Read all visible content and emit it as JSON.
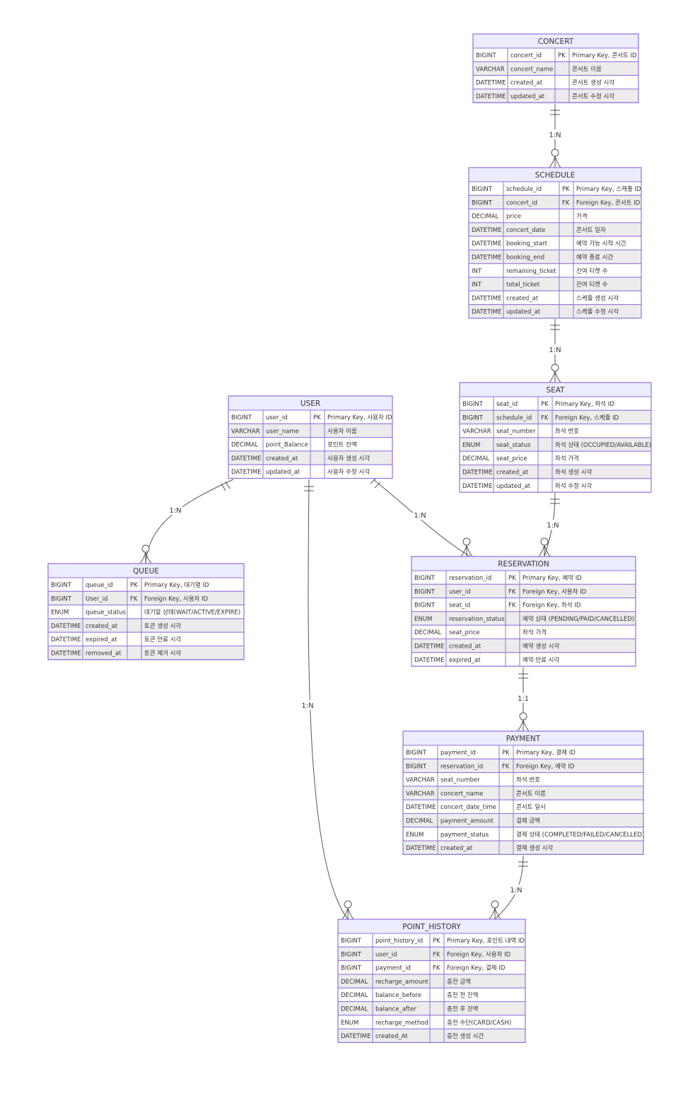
{
  "entities": [
    {
      "id": "CONCERT",
      "name": "CONCERT",
      "attributes": [
        [
          "BIGINT",
          "concert_id",
          "PK",
          "Primary Key, 콘서트 ID"
        ],
        [
          "VARCHAR",
          "concert_name",
          "",
          "콘서트 이름"
        ],
        [
          "DATETIME",
          "created_at",
          "",
          "콘서트 생성 시각"
        ],
        [
          "DATETIME",
          "updated_at",
          "",
          "콘서트 수정 시각"
        ]
      ]
    },
    {
      "id": "SCHEDULE",
      "name": "SCHEDULE",
      "attributes": [
        [
          "BIGINT",
          "schedule_id",
          "PK",
          "Primary Key, 스케줄 ID"
        ],
        [
          "BIGINT",
          "concert_id",
          "FK",
          "Foreign Key, 콘서트 ID"
        ],
        [
          "DECIMAL",
          "price",
          "",
          "가격"
        ],
        [
          "DATETIME",
          "concert_date",
          "",
          "콘서트 일자"
        ],
        [
          "DATETIME",
          "booking_start",
          "",
          "예약 가능 시작 시간"
        ],
        [
          "DATETIME",
          "booking_end",
          "",
          "예약 종료 시간"
        ],
        [
          "INT",
          "remaining_ticket",
          "",
          "잔여 티켓 수"
        ],
        [
          "INT",
          "total_ticket",
          "",
          "잔여 티켓 수"
        ],
        [
          "DATETIME",
          "created_at",
          "",
          "스케줄 생성 시각"
        ],
        [
          "DATETIME",
          "updated_at",
          "",
          "스케줄 수정 시각"
        ]
      ]
    },
    {
      "id": "SEAT",
      "name": "SEAT",
      "attributes": [
        [
          "BIGINT",
          "seat_id",
          "PK",
          "Primary Key, 좌석 ID"
        ],
        [
          "BIGINT",
          "schedule_id",
          "FK",
          "Foreign Key, 스케줄 ID"
        ],
        [
          "VARCHAR",
          "seat_number",
          "",
          "좌석 번호"
        ],
        [
          "ENUM",
          "seat_status",
          "",
          "좌석 상태 (OCCUPIED/AVAILABLE)"
        ],
        [
          "DECIMAL",
          "seat_price",
          "",
          "좌석 가격"
        ],
        [
          "DATETIME",
          "created_at",
          "",
          "좌석 생성 시각"
        ],
        [
          "DATETIME",
          "updated_at",
          "",
          "좌석 수정 시각"
        ]
      ]
    },
    {
      "id": "USER",
      "name": "USER",
      "attributes": [
        [
          "BIGINT",
          "user_id",
          "PK",
          "Primary Key, 사용자 ID"
        ],
        [
          "VARCHAR",
          "user_name",
          "",
          "사용자 이름"
        ],
        [
          "DECIMAL",
          "point_Balance",
          "",
          "포인트 잔액"
        ],
        [
          "DATETIME",
          "created_at",
          "",
          "사용자 생성 시각"
        ],
        [
          "DATETIME",
          "updated_at",
          "",
          "사용자 수정 시각"
        ]
      ]
    },
    {
      "id": "QUEUE",
      "name": "QUEUE",
      "attributes": [
        [
          "BIGINT",
          "queue_id",
          "PK",
          "Primary Key, 대기열 ID"
        ],
        [
          "BIGINT",
          "User_id",
          "FK",
          "Foreign Key, 사용자 ID"
        ],
        [
          "ENUM",
          "queue_status",
          "",
          "대기열 상태(WAIT/ACTIVE/EXPIRE)"
        ],
        [
          "DATETIME",
          "created_at",
          "",
          "토큰 생성 시각"
        ],
        [
          "DATETIME",
          "expired_at",
          "",
          "토큰 만료 시각"
        ],
        [
          "DATETIME",
          "removed_at",
          "",
          "토큰 제거 시각"
        ]
      ]
    },
    {
      "id": "RESERVATION",
      "name": "RESERVATION",
      "attributes": [
        [
          "BIGINT",
          "reservation_id",
          "PK",
          "Primary Key, 예약 ID"
        ],
        [
          "BIGINT",
          "user_id",
          "FK",
          "Foreign Key, 사용자 ID"
        ],
        [
          "BIGINT",
          "seat_id",
          "FK",
          "Foreign Key, 좌석 ID"
        ],
        [
          "ENUM",
          "reservation_status",
          "",
          "예약 상태 (PENDING/PAID/CANCELLED)"
        ],
        [
          "DECIMAL",
          "seat_price",
          "",
          "좌석 가격"
        ],
        [
          "DATETIME",
          "created_at",
          "",
          "예약 생성 시각"
        ],
        [
          "DATETIME",
          "expired_at",
          "",
          "예약 만료 시각"
        ]
      ]
    },
    {
      "id": "PAYMENT",
      "name": "PAYMENT",
      "attributes": [
        [
          "BIGINT",
          "payment_id",
          "PK",
          "Primary Key, 결제 ID"
        ],
        [
          "BIGINT",
          "reservation_id",
          "FK",
          "Foreign Key, 예약 ID"
        ],
        [
          "VARCHAR",
          "seat_number",
          "",
          "좌석 번호"
        ],
        [
          "VARCHAR",
          "concert_name",
          "",
          "콘서트 이름"
        ],
        [
          "DATETIME",
          "concert_date_time",
          "",
          "콘서트 일시"
        ],
        [
          "DECIMAL",
          "payment_amount",
          "",
          "결제 금액"
        ],
        [
          "ENUM",
          "payment_status",
          "",
          "결제 상태 (COMPLETED/FAILED/CANCELLED)"
        ],
        [
          "DATETIME",
          "created_at",
          "",
          "결제 생성 시각"
        ]
      ]
    },
    {
      "id": "POINT_HISTORY",
      "name": "POINT_HISTORY",
      "attributes": [
        [
          "BIGINT",
          "point_history_id",
          "PK",
          "Primary Key, 포인트 내역 ID"
        ],
        [
          "BIGINT",
          "user_id",
          "FK",
          "Foreign Key, 사용자 ID"
        ],
        [
          "BIGINT",
          "payment_id",
          "FK",
          "Foreign Key, 결제 ID"
        ],
        [
          "DECIMAL",
          "recharge_amount",
          "",
          "충전 금액"
        ],
        [
          "DECIMAL",
          "balance_before",
          "",
          "충전 전 잔액"
        ],
        [
          "DECIMAL",
          "balance_after",
          "",
          "충전 후 잔액"
        ],
        [
          "ENUM",
          "recharge_method",
          "",
          "충전 수단(CARD/CASH)"
        ],
        [
          "DATETIME",
          "created_At",
          "",
          "충전 생성 시간"
        ]
      ]
    }
  ],
  "relationships": [
    {
      "from": "CONCERT",
      "to": "SCHEDULE",
      "label": "1:N"
    },
    {
      "from": "SCHEDULE",
      "to": "SEAT",
      "label": "1:N"
    },
    {
      "from": "SEAT",
      "to": "RESERVATION",
      "label": "1:N"
    },
    {
      "from": "USER",
      "to": "QUEUE",
      "label": "1:N"
    },
    {
      "from": "USER",
      "to": "RESERVATION",
      "label": "1:N"
    },
    {
      "from": "USER",
      "to": "POINT_HISTORY",
      "label": "1:N"
    },
    {
      "from": "RESERVATION",
      "to": "PAYMENT",
      "label": "1:1"
    },
    {
      "from": "PAYMENT",
      "to": "POINT_HISTORY",
      "label": "1:N"
    }
  ],
  "colors": {
    "title_fill": "#ECECFF",
    "border": "#9370DB",
    "row_odd": "#ffffff",
    "row_even": "#ECECEC",
    "text": "#333333",
    "line": "#555555"
  }
}
